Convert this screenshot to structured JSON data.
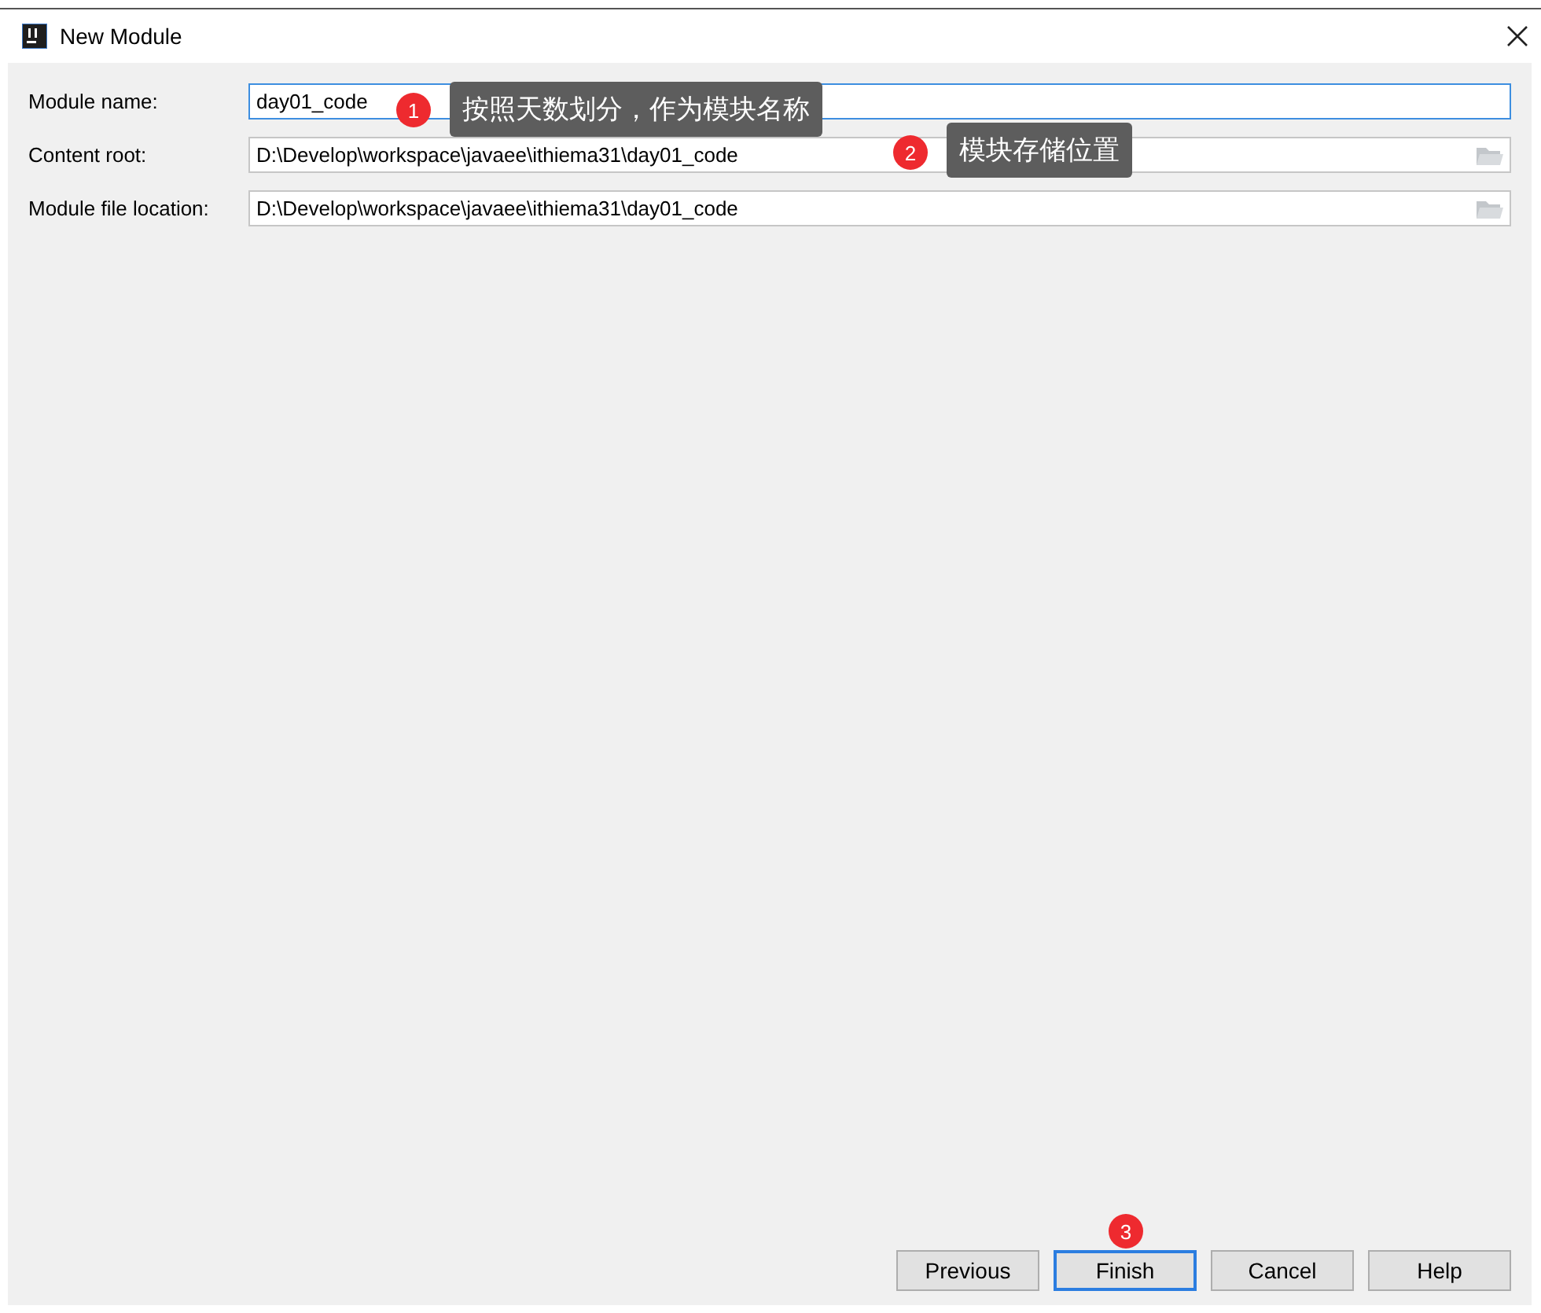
{
  "window": {
    "title": "New Module"
  },
  "fields": [
    {
      "label": "Module name:",
      "value": "day01_code",
      "focused": true,
      "browse": false
    },
    {
      "label": "Content root:",
      "value": "D:\\Develop\\workspace\\javaee\\ithiema31\\day01_code",
      "focused": false,
      "browse": true
    },
    {
      "label": "Module file location:",
      "value": "D:\\Develop\\workspace\\javaee\\ithiema31\\day01_code",
      "focused": false,
      "browse": true
    }
  ],
  "buttons": [
    {
      "label": "Previous",
      "default": false
    },
    {
      "label": "Finish",
      "default": true
    },
    {
      "label": "Cancel",
      "default": false
    },
    {
      "label": "Help",
      "default": false
    }
  ],
  "annotations": [
    {
      "number": "1",
      "text": "按照天数划分，作为模块名称"
    },
    {
      "number": "2",
      "text": "模块存储位置"
    },
    {
      "number": "3"
    }
  ]
}
